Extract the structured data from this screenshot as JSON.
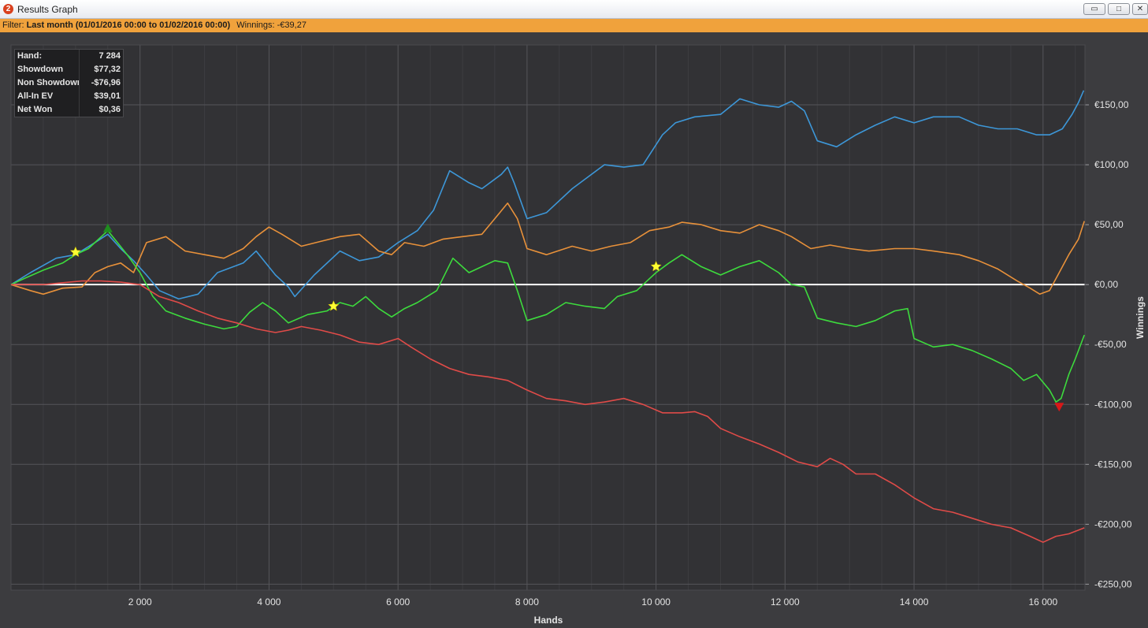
{
  "window": {
    "title": "Results Graph",
    "app_icon": "2"
  },
  "filter": {
    "label": "Filter:",
    "value": "Last month (01/01/2016 00:00 to 01/02/2016 00:00)",
    "winnings_label": "Winnings:",
    "winnings_value": "-€39,27"
  },
  "stats": [
    {
      "label": "Hand:",
      "value": "7 284"
    },
    {
      "label": "Showdown",
      "value": "$77,32"
    },
    {
      "label": "Non Showdown",
      "value": "-$76,96"
    },
    {
      "label": "All-In EV",
      "value": "$39,01"
    },
    {
      "label": "Net Won",
      "value": "$0,36"
    }
  ],
  "chart_data": {
    "type": "line",
    "xlabel": "Hands",
    "ylabel": "Winnings",
    "xlim": [
      0,
      16650
    ],
    "ylim": [
      -255,
      200
    ],
    "x_ticks": [
      2000,
      4000,
      6000,
      8000,
      10000,
      12000,
      14000,
      16000
    ],
    "x_tick_labels": [
      "2 000",
      "4 000",
      "6 000",
      "8 000",
      "10 000",
      "12 000",
      "14 000",
      "16 000"
    ],
    "y_ticks": [
      150,
      100,
      50,
      0,
      -50,
      -100,
      -150,
      -200,
      -250
    ],
    "y_tick_labels": [
      "€150,00",
      "€100,00",
      "€50,00",
      "€0,00",
      "-€50,00",
      "-€100,00",
      "-€150,00",
      "-€200,00",
      "-€250,00"
    ],
    "grid": true,
    "y_axis_side": "right",
    "zero_line_color": "#ffffff",
    "series": [
      {
        "color": "#3d97d8",
        "points": [
          [
            0,
            0
          ],
          [
            300,
            10
          ],
          [
            700,
            22
          ],
          [
            1000,
            25
          ],
          [
            1300,
            35
          ],
          [
            1500,
            42
          ],
          [
            1700,
            30
          ],
          [
            1900,
            20
          ],
          [
            2100,
            8
          ],
          [
            2300,
            -5
          ],
          [
            2600,
            -12
          ],
          [
            2900,
            -8
          ],
          [
            3200,
            10
          ],
          [
            3600,
            18
          ],
          [
            3800,
            28
          ],
          [
            4100,
            8
          ],
          [
            4300,
            -2
          ],
          [
            4400,
            -10
          ],
          [
            4700,
            8
          ],
          [
            5100,
            28
          ],
          [
            5400,
            20
          ],
          [
            5700,
            23
          ],
          [
            6000,
            35
          ],
          [
            6300,
            45
          ],
          [
            6550,
            62
          ],
          [
            6800,
            95
          ],
          [
            7100,
            85
          ],
          [
            7300,
            80
          ],
          [
            7600,
            92
          ],
          [
            7700,
            98
          ],
          [
            7800,
            85
          ],
          [
            8000,
            55
          ],
          [
            8300,
            60
          ],
          [
            8700,
            80
          ],
          [
            9200,
            100
          ],
          [
            9500,
            98
          ],
          [
            9800,
            100
          ],
          [
            10100,
            125
          ],
          [
            10300,
            135
          ],
          [
            10600,
            140
          ],
          [
            11000,
            142
          ],
          [
            11300,
            155
          ],
          [
            11600,
            150
          ],
          [
            11900,
            148
          ],
          [
            12100,
            153
          ],
          [
            12300,
            145
          ],
          [
            12500,
            120
          ],
          [
            12800,
            115
          ],
          [
            13100,
            125
          ],
          [
            13400,
            133
          ],
          [
            13700,
            140
          ],
          [
            14000,
            135
          ],
          [
            14300,
            140
          ],
          [
            14700,
            140
          ],
          [
            15000,
            133
          ],
          [
            15300,
            130
          ],
          [
            15600,
            130
          ],
          [
            15900,
            125
          ],
          [
            16100,
            125
          ],
          [
            16300,
            130
          ],
          [
            16450,
            142
          ],
          [
            16550,
            152
          ],
          [
            16630,
            162
          ]
        ]
      },
      {
        "color": "#e8913a",
        "points": [
          [
            0,
            0
          ],
          [
            300,
            -5
          ],
          [
            500,
            -8
          ],
          [
            800,
            -3
          ],
          [
            1100,
            -2
          ],
          [
            1300,
            10
          ],
          [
            1500,
            15
          ],
          [
            1700,
            18
          ],
          [
            1900,
            10
          ],
          [
            2100,
            35
          ],
          [
            2400,
            40
          ],
          [
            2700,
            28
          ],
          [
            3000,
            25
          ],
          [
            3300,
            22
          ],
          [
            3600,
            30
          ],
          [
            3800,
            40
          ],
          [
            4000,
            48
          ],
          [
            4200,
            42
          ],
          [
            4500,
            32
          ],
          [
            4800,
            36
          ],
          [
            5100,
            40
          ],
          [
            5400,
            42
          ],
          [
            5700,
            28
          ],
          [
            5900,
            25
          ],
          [
            6100,
            35
          ],
          [
            6400,
            32
          ],
          [
            6700,
            38
          ],
          [
            7000,
            40
          ],
          [
            7300,
            42
          ],
          [
            7500,
            55
          ],
          [
            7700,
            68
          ],
          [
            7850,
            55
          ],
          [
            8000,
            30
          ],
          [
            8300,
            25
          ],
          [
            8700,
            32
          ],
          [
            9000,
            28
          ],
          [
            9300,
            32
          ],
          [
            9600,
            35
          ],
          [
            9900,
            45
          ],
          [
            10200,
            48
          ],
          [
            10400,
            52
          ],
          [
            10700,
            50
          ],
          [
            11000,
            45
          ],
          [
            11300,
            43
          ],
          [
            11600,
            50
          ],
          [
            11900,
            45
          ],
          [
            12100,
            40
          ],
          [
            12400,
            30
          ],
          [
            12700,
            33
          ],
          [
            13000,
            30
          ],
          [
            13300,
            28
          ],
          [
            13700,
            30
          ],
          [
            14000,
            30
          ],
          [
            14300,
            28
          ],
          [
            14700,
            25
          ],
          [
            15000,
            20
          ],
          [
            15300,
            13
          ],
          [
            15600,
            3
          ],
          [
            15800,
            -3
          ],
          [
            15950,
            -8
          ],
          [
            16100,
            -5
          ],
          [
            16250,
            10
          ],
          [
            16400,
            25
          ],
          [
            16550,
            38
          ],
          [
            16640,
            53
          ]
        ]
      },
      {
        "color": "#3ddb3d",
        "points": [
          [
            0,
            0
          ],
          [
            200,
            5
          ],
          [
            500,
            12
          ],
          [
            800,
            18
          ],
          [
            1000,
            25
          ],
          [
            1200,
            30
          ],
          [
            1400,
            40
          ],
          [
            1500,
            45
          ],
          [
            1650,
            35
          ],
          [
            1800,
            25
          ],
          [
            2000,
            10
          ],
          [
            2200,
            -10
          ],
          [
            2400,
            -22
          ],
          [
            2700,
            -28
          ],
          [
            3000,
            -33
          ],
          [
            3300,
            -37
          ],
          [
            3500,
            -35
          ],
          [
            3700,
            -23
          ],
          [
            3900,
            -15
          ],
          [
            4100,
            -22
          ],
          [
            4300,
            -32
          ],
          [
            4600,
            -25
          ],
          [
            4900,
            -22
          ],
          [
            5100,
            -15
          ],
          [
            5300,
            -18
          ],
          [
            5500,
            -10
          ],
          [
            5700,
            -20
          ],
          [
            5900,
            -27
          ],
          [
            6100,
            -20
          ],
          [
            6300,
            -15
          ],
          [
            6600,
            -5
          ],
          [
            6850,
            22
          ],
          [
            7100,
            10
          ],
          [
            7300,
            15
          ],
          [
            7500,
            20
          ],
          [
            7700,
            18
          ],
          [
            7850,
            -5
          ],
          [
            8000,
            -30
          ],
          [
            8300,
            -25
          ],
          [
            8600,
            -15
          ],
          [
            8900,
            -18
          ],
          [
            9200,
            -20
          ],
          [
            9400,
            -10
          ],
          [
            9700,
            -5
          ],
          [
            9900,
            5
          ],
          [
            10000,
            10
          ],
          [
            10200,
            18
          ],
          [
            10400,
            25
          ],
          [
            10700,
            15
          ],
          [
            11000,
            8
          ],
          [
            11300,
            15
          ],
          [
            11600,
            20
          ],
          [
            11900,
            10
          ],
          [
            12100,
            0
          ],
          [
            12300,
            -2
          ],
          [
            12500,
            -28
          ],
          [
            12800,
            -32
          ],
          [
            13100,
            -35
          ],
          [
            13400,
            -30
          ],
          [
            13700,
            -22
          ],
          [
            13900,
            -20
          ],
          [
            14000,
            -45
          ],
          [
            14300,
            -52
          ],
          [
            14600,
            -50
          ],
          [
            14900,
            -55
          ],
          [
            15200,
            -62
          ],
          [
            15500,
            -70
          ],
          [
            15700,
            -80
          ],
          [
            15900,
            -75
          ],
          [
            16100,
            -88
          ],
          [
            16200,
            -98
          ],
          [
            16280,
            -95
          ],
          [
            16400,
            -75
          ],
          [
            16500,
            -62
          ],
          [
            16640,
            -42
          ]
        ]
      },
      {
        "color": "#e04b48",
        "points": [
          [
            0,
            0
          ],
          [
            500,
            0
          ],
          [
            900,
            2
          ],
          [
            1100,
            3
          ],
          [
            1400,
            3
          ],
          [
            1700,
            2
          ],
          [
            2000,
            0
          ],
          [
            2300,
            -10
          ],
          [
            2600,
            -15
          ],
          [
            2900,
            -22
          ],
          [
            3200,
            -28
          ],
          [
            3500,
            -32
          ],
          [
            3800,
            -37
          ],
          [
            4100,
            -40
          ],
          [
            4300,
            -38
          ],
          [
            4500,
            -35
          ],
          [
            4800,
            -38
          ],
          [
            5100,
            -42
          ],
          [
            5400,
            -48
          ],
          [
            5700,
            -50
          ],
          [
            6000,
            -45
          ],
          [
            6200,
            -52
          ],
          [
            6500,
            -62
          ],
          [
            6800,
            -70
          ],
          [
            7100,
            -75
          ],
          [
            7400,
            -77
          ],
          [
            7700,
            -80
          ],
          [
            8000,
            -88
          ],
          [
            8300,
            -95
          ],
          [
            8600,
            -97
          ],
          [
            8900,
            -100
          ],
          [
            9200,
            -98
          ],
          [
            9500,
            -95
          ],
          [
            9800,
            -100
          ],
          [
            10100,
            -107
          ],
          [
            10400,
            -107
          ],
          [
            10600,
            -106
          ],
          [
            10800,
            -110
          ],
          [
            11000,
            -120
          ],
          [
            11300,
            -127
          ],
          [
            11600,
            -133
          ],
          [
            11900,
            -140
          ],
          [
            12200,
            -148
          ],
          [
            12500,
            -152
          ],
          [
            12700,
            -145
          ],
          [
            12900,
            -150
          ],
          [
            13100,
            -158
          ],
          [
            13400,
            -158
          ],
          [
            13700,
            -167
          ],
          [
            14000,
            -178
          ],
          [
            14300,
            -187
          ],
          [
            14600,
            -190
          ],
          [
            14900,
            -195
          ],
          [
            15200,
            -200
          ],
          [
            15500,
            -203
          ],
          [
            15800,
            -210
          ],
          [
            16000,
            -215
          ],
          [
            16200,
            -210
          ],
          [
            16400,
            -208
          ],
          [
            16640,
            -203
          ]
        ]
      }
    ],
    "markers": [
      {
        "shape": "star",
        "color": "#ffff33",
        "x": 1000,
        "y": 27
      },
      {
        "shape": "star",
        "color": "#ffff33",
        "x": 5000,
        "y": -18
      },
      {
        "shape": "star",
        "color": "#ffff33",
        "x": 10000,
        "y": 15
      },
      {
        "shape": "triangle-up",
        "color": "#1f8c1f",
        "x": 1500,
        "y": 47
      },
      {
        "shape": "triangle-down",
        "color": "#d81818",
        "x": 16250,
        "y": -102
      }
    ]
  }
}
